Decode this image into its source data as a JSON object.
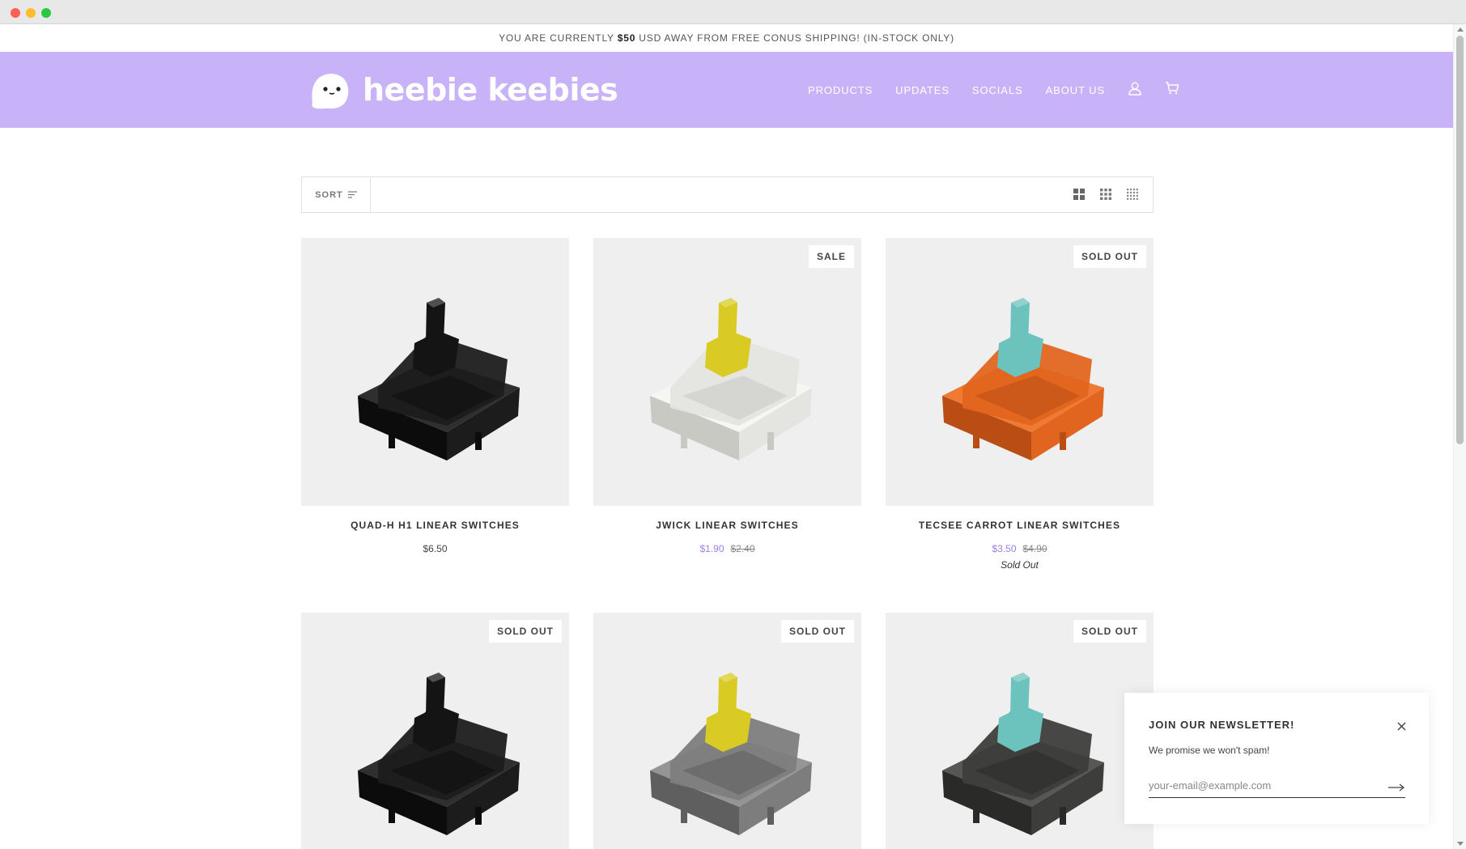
{
  "announcement": {
    "before": "YOU ARE CURRENTLY ",
    "amount": "$50",
    "after": " USD AWAY FROM FREE CONUS SHIPPING! (IN-STOCK ONLY)"
  },
  "header": {
    "brand": "heebie keebies",
    "accent_color": "#c8b3f8",
    "nav": [
      "PRODUCTS",
      "UPDATES",
      "SOCIALS",
      "ABOUT US"
    ],
    "icons": [
      "account-icon",
      "cart-icon"
    ]
  },
  "toolbar": {
    "sort_label": "SORT",
    "view_icons": [
      "grid-2-icon",
      "grid-3-icon",
      "grid-4-icon"
    ]
  },
  "products": [
    {
      "title": "QUAD-H H1 LINEAR SWITCHES",
      "price": "$6.50",
      "sale_price": "",
      "compare_price": "",
      "badge": "",
      "note": "",
      "housing": "black",
      "stem": "black"
    },
    {
      "title": "JWICK LINEAR SWITCHES",
      "price": "",
      "sale_price": "$1.90",
      "compare_price": "$2.40",
      "badge": "SALE",
      "note": "",
      "housing": "clear",
      "stem": "yellow"
    },
    {
      "title": "TECSEE CARROT LINEAR SWITCHES",
      "price": "",
      "sale_price": "$3.50",
      "compare_price": "$4.90",
      "badge": "SOLD OUT",
      "note": "Sold Out",
      "housing": "orange",
      "stem": "teal"
    },
    {
      "title": "",
      "price": "",
      "sale_price": "",
      "compare_price": "",
      "badge": "SOLD OUT",
      "note": "",
      "housing": "black",
      "stem": "black"
    },
    {
      "title": "",
      "price": "",
      "sale_price": "",
      "compare_price": "",
      "badge": "SOLD OUT",
      "note": "",
      "housing": "grey",
      "stem": "yellow"
    },
    {
      "title": "",
      "price": "",
      "sale_price": "",
      "compare_price": "",
      "badge": "SOLD OUT",
      "note": "",
      "housing": "smoke",
      "stem": "teal"
    }
  ],
  "newsletter": {
    "title": "JOIN OUR NEWSLETTER!",
    "subtitle": "We promise we won't spam!",
    "placeholder": "your-email@example.com"
  }
}
